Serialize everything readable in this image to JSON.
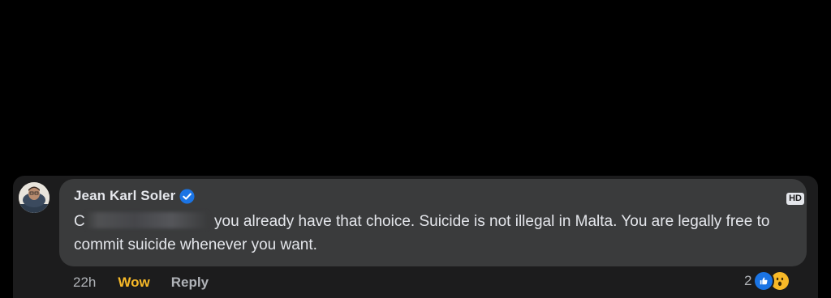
{
  "comment": {
    "author": "Jean Karl Soler",
    "verified": true,
    "text_start": "C",
    "text_rest": " you already have that choice. Suicide is not illegal in Malta. You are legally free to commit suicide whenever you want.",
    "hd_label": "HD"
  },
  "actions": {
    "time": "22h",
    "reaction": "Wow",
    "reply": "Reply"
  },
  "reactions": {
    "count": "2",
    "types": [
      "like-icon",
      "wow-icon"
    ]
  },
  "colors": {
    "background": "#000000",
    "bubble": "#3a3b3c",
    "text": "#e4e6eb",
    "wow": "#f7b928",
    "like": "#1b74e4"
  }
}
